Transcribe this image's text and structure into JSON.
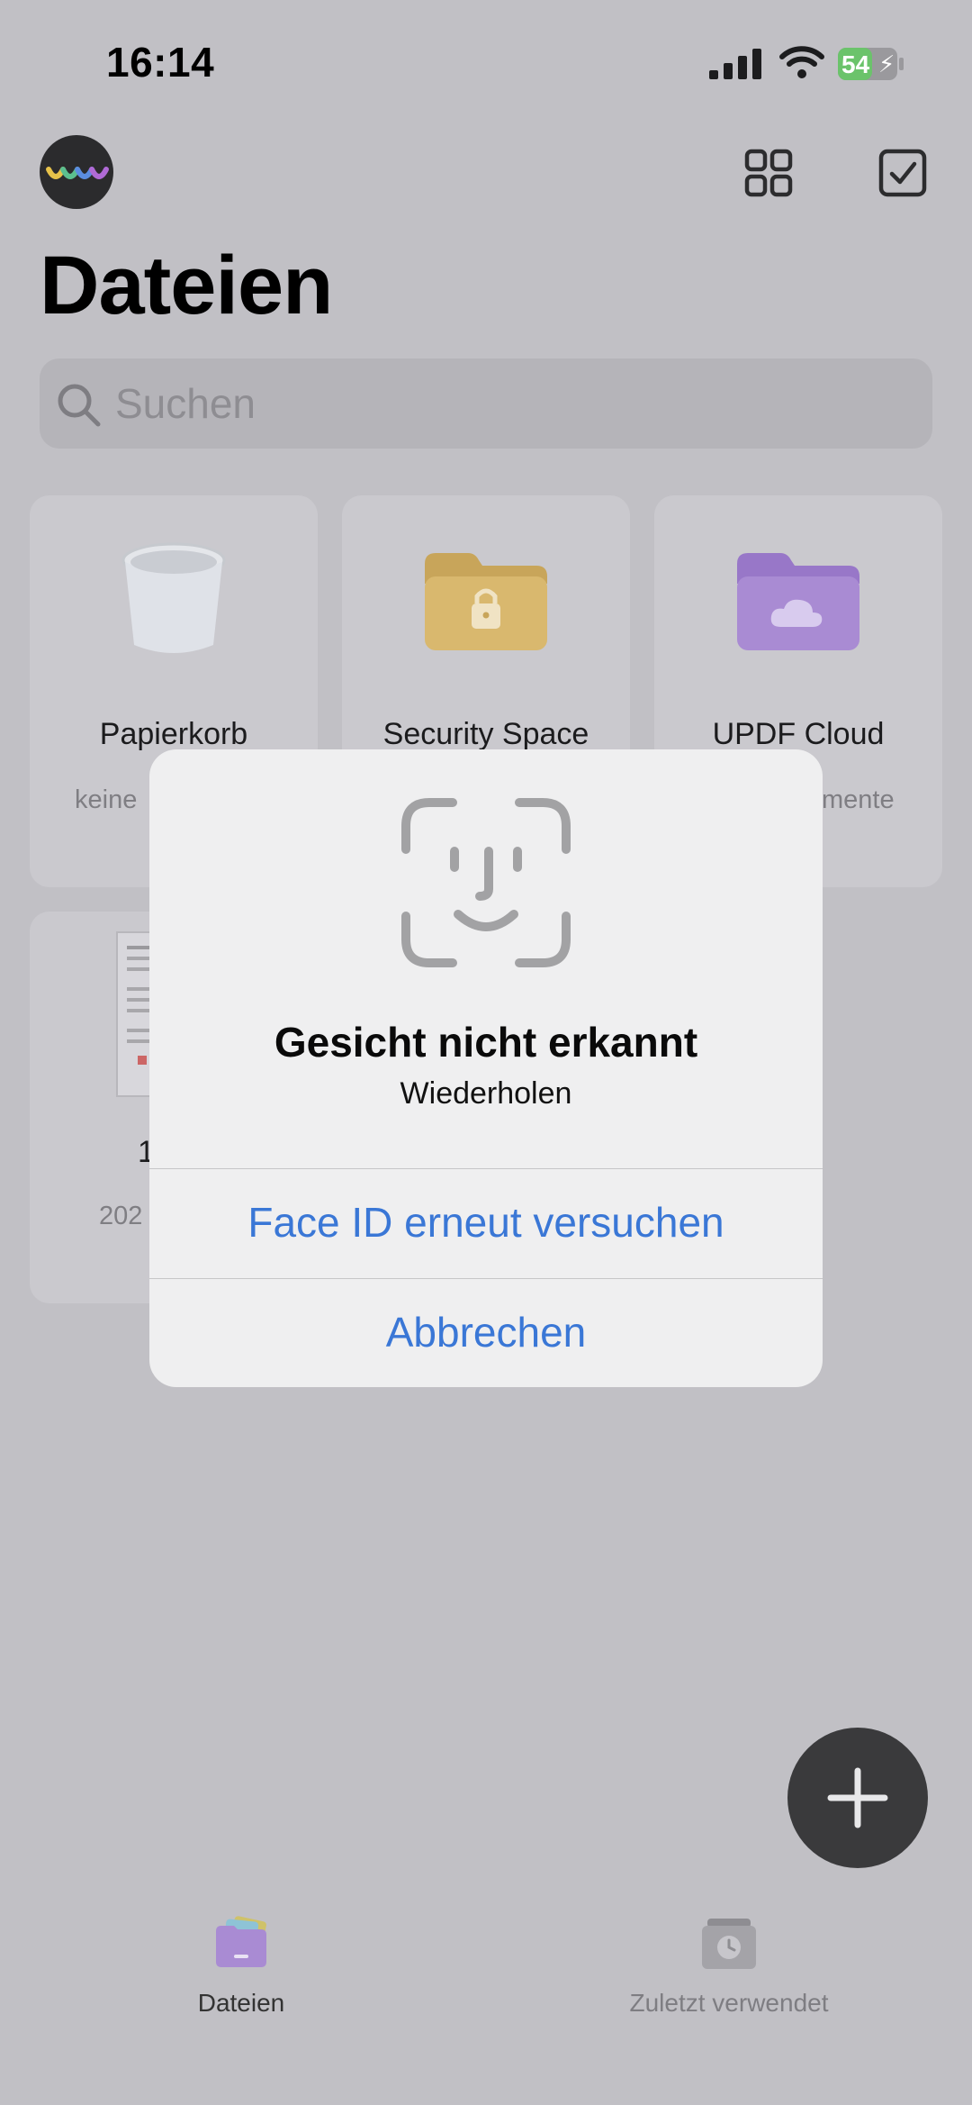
{
  "status_bar": {
    "time": "16:14",
    "battery": "54"
  },
  "header": {
    "title": "Dateien"
  },
  "search": {
    "placeholder": "Suchen"
  },
  "cards": [
    {
      "title": "Papierkorb",
      "subtitle": "keine"
    },
    {
      "title": "Security Space"
    },
    {
      "title": "UPDF Cloud",
      "subtitle": "mente"
    },
    {
      "title": "1",
      "subtitle": "202"
    }
  ],
  "dialog": {
    "title": "Gesicht nicht erkannt",
    "subtitle": "Wiederholen",
    "retry_label": "Face ID erneut versuchen",
    "cancel_label": "Abbrechen"
  },
  "tab_bar": {
    "items": [
      {
        "label": "Dateien",
        "active": true
      },
      {
        "label": "Zuletzt verwendet",
        "active": false
      }
    ]
  },
  "colors": {
    "accent": "#3a77d6",
    "battery_green": "#6bc36b",
    "folder_yellow": "#d6b56a",
    "folder_purple": "#a98bd3"
  }
}
